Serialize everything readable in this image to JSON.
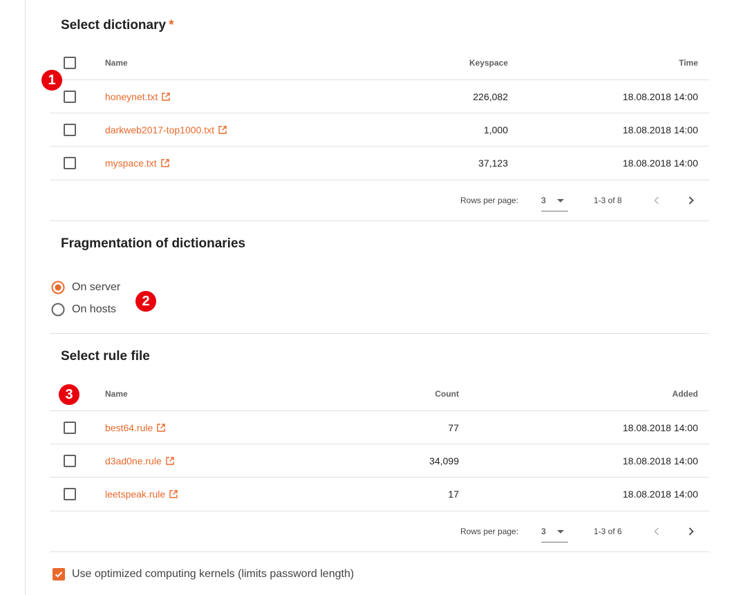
{
  "dictionary_section": {
    "title": "Select dictionary",
    "required_mark": "*",
    "columns": {
      "name": "Name",
      "keyspace": "Keyspace",
      "time": "Time"
    },
    "rows": [
      {
        "name": "honeynet.txt",
        "keyspace": "226,082",
        "time": "18.08.2018 14:00"
      },
      {
        "name": "darkweb2017-top1000.txt",
        "keyspace": "1,000",
        "time": "18.08.2018 14:00"
      },
      {
        "name": "myspace.txt",
        "keyspace": "37,123",
        "time": "18.08.2018 14:00"
      }
    ],
    "footer": {
      "rows_per_page_label": "Rows per page:",
      "rows_per_page": "3",
      "range": "1-3 of 8"
    }
  },
  "fragmentation_section": {
    "title": "Fragmentation of dictionaries",
    "options": [
      {
        "label": "On server",
        "selected": true
      },
      {
        "label": "On hosts",
        "selected": false
      }
    ]
  },
  "rule_section": {
    "title": "Select rule file",
    "columns": {
      "name": "Name",
      "count": "Count",
      "added": "Added"
    },
    "rows": [
      {
        "name": "best64.rule",
        "count": "77",
        "added": "18.08.2018 14:00"
      },
      {
        "name": "d3ad0ne.rule",
        "count": "34,099",
        "added": "18.08.2018 14:00"
      },
      {
        "name": "leetspeak.rule",
        "count": "17",
        "added": "18.08.2018 14:00"
      }
    ],
    "footer": {
      "rows_per_page_label": "Rows per page:",
      "rows_per_page": "3",
      "range": "1-3 of 6"
    }
  },
  "optimized_kernels": {
    "label": "Use optimized computing kernels (limits password length)",
    "checked": true
  },
  "callouts": [
    "1",
    "2",
    "3"
  ],
  "colors": {
    "accent": "#e8692c",
    "callout": "#e8000d",
    "divider": "#e0e0e0"
  },
  "icons": {
    "external_link": "open-in-new-icon",
    "prev": "chevron-left-icon",
    "next": "chevron-right-icon"
  }
}
